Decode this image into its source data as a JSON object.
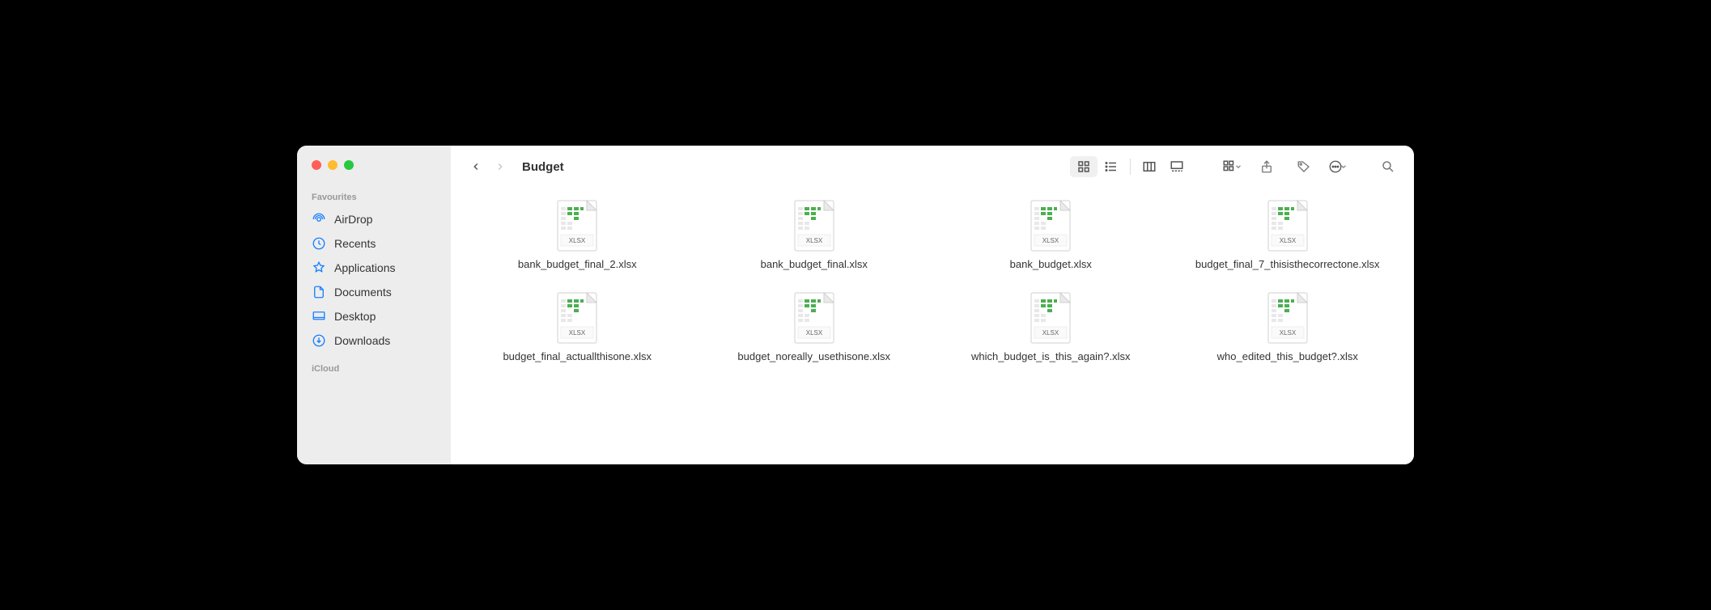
{
  "window": {
    "title": "Budget"
  },
  "sidebar": {
    "sections": [
      {
        "title": "Favourites",
        "items": [
          {
            "icon": "airdrop",
            "label": "AirDrop"
          },
          {
            "icon": "recents",
            "label": "Recents"
          },
          {
            "icon": "applications",
            "label": "Applications"
          },
          {
            "icon": "documents",
            "label": "Documents"
          },
          {
            "icon": "desktop",
            "label": "Desktop"
          },
          {
            "icon": "downloads",
            "label": "Downloads"
          }
        ]
      },
      {
        "title": "iCloud",
        "items": []
      }
    ]
  },
  "files": [
    {
      "name": "bank_budget_final_2.xlsx",
      "type": "XLSX"
    },
    {
      "name": "bank_budget_final.xlsx",
      "type": "XLSX"
    },
    {
      "name": "bank_budget.xlsx",
      "type": "XLSX"
    },
    {
      "name": "budget_final_7_thisisthecorrectone.xlsx",
      "type": "XLSX"
    },
    {
      "name": "budget_final_actuallthisone.xlsx",
      "type": "XLSX"
    },
    {
      "name": "budget_noreally_usethisone.xlsx",
      "type": "XLSX"
    },
    {
      "name": "which_budget_is_this_again?.xlsx",
      "type": "XLSX"
    },
    {
      "name": "who_edited_this_budget?.xlsx",
      "type": "XLSX"
    }
  ]
}
